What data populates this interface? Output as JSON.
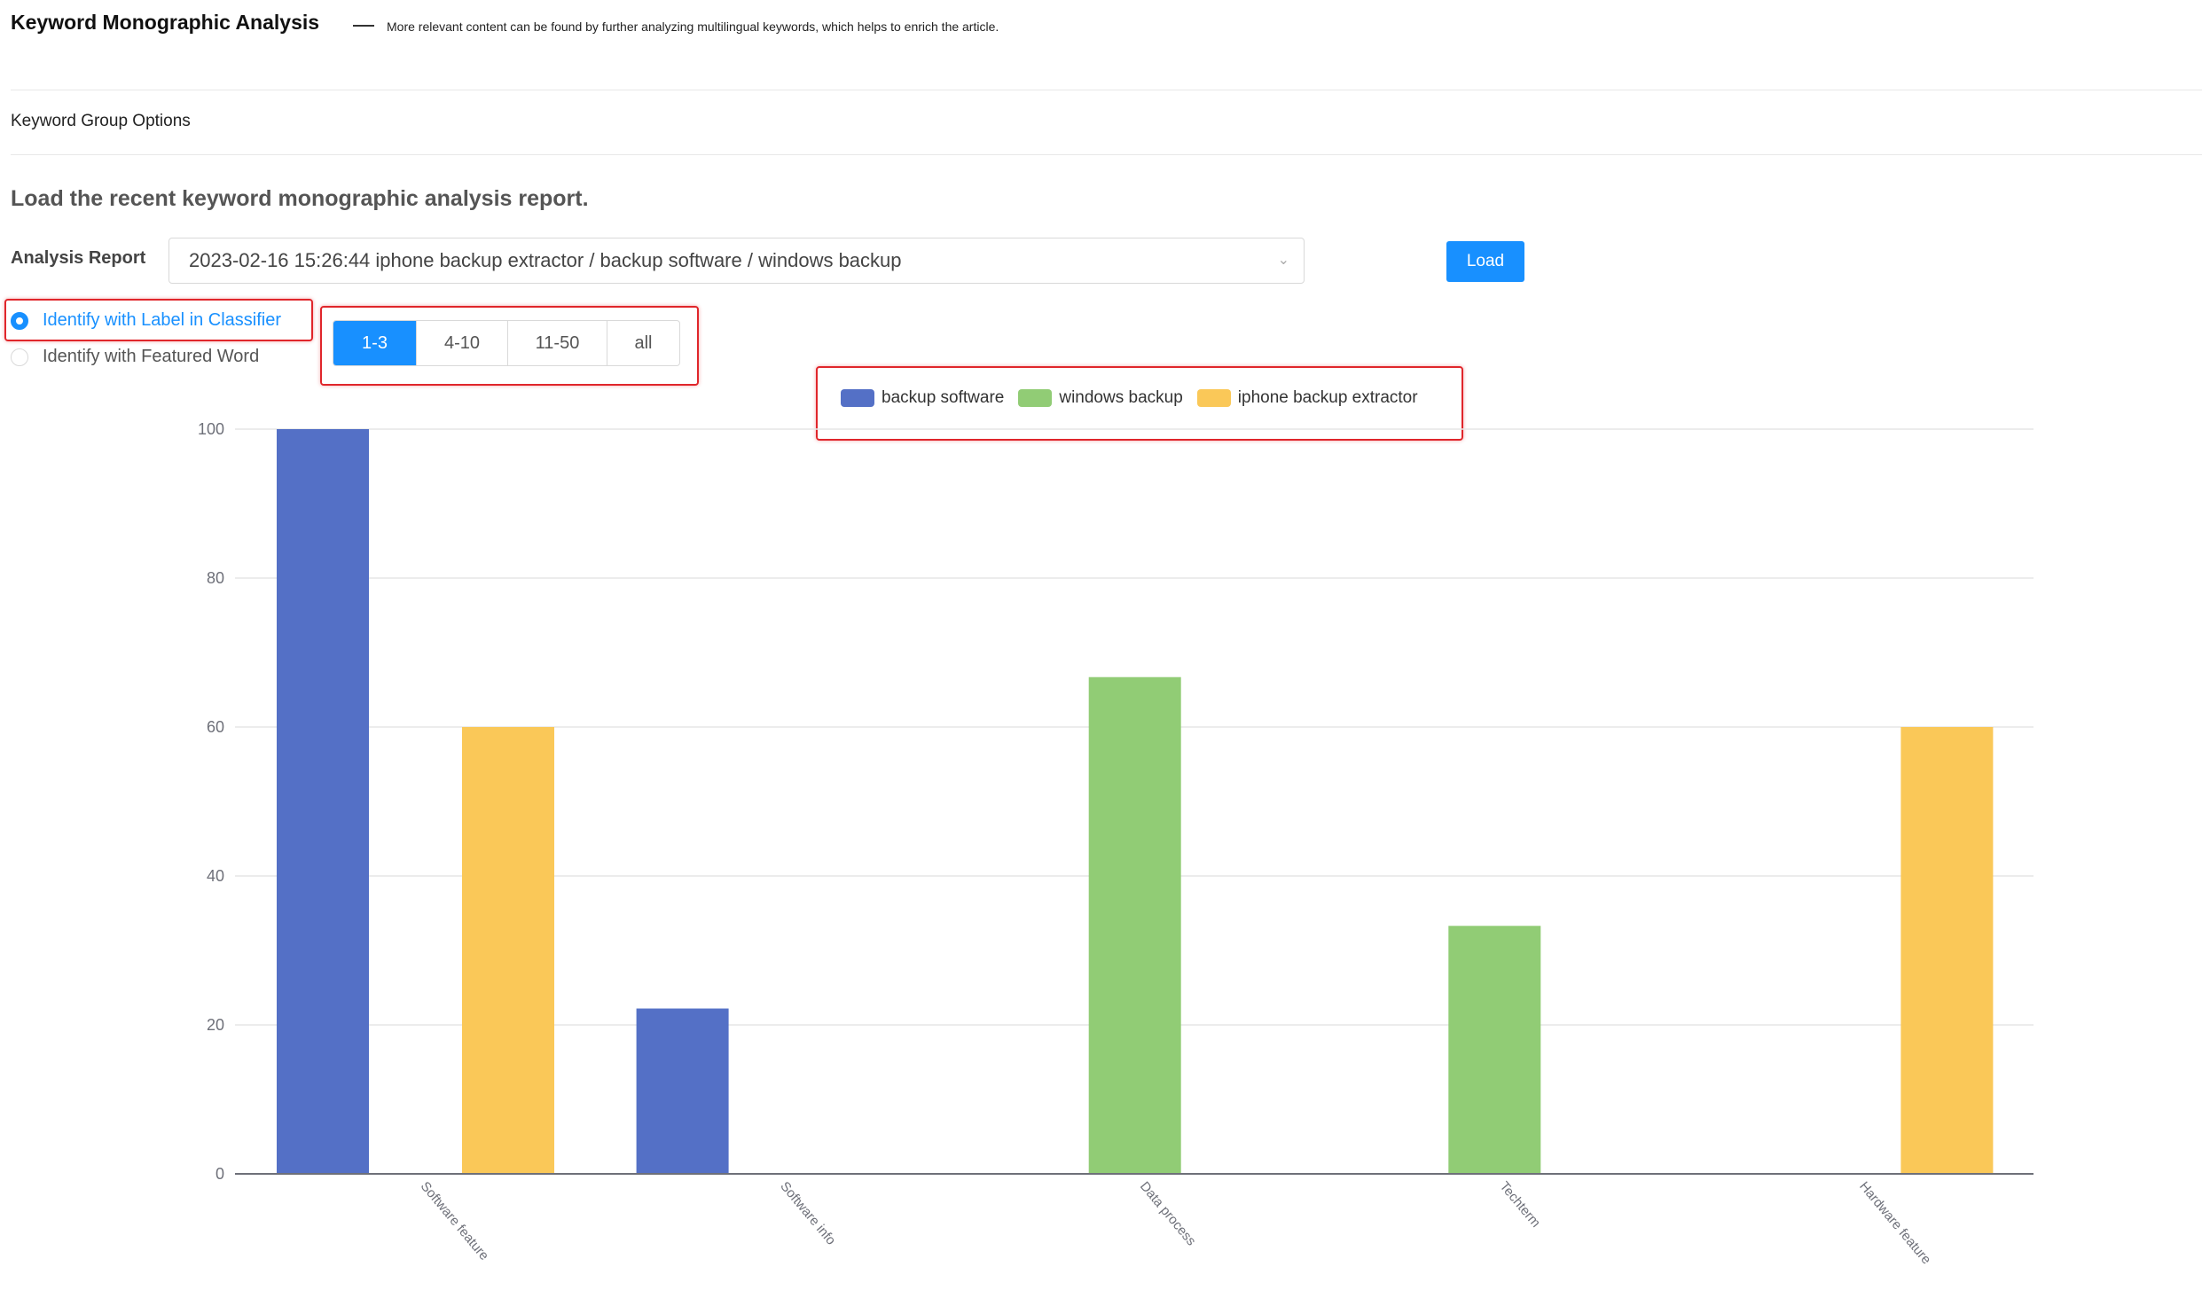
{
  "header": {
    "title": "Keyword Monographic Analysis",
    "subtitle": "More relevant content can be found by further analyzing multilingual keywords, which helps to enrich the article."
  },
  "section": {
    "label": "Keyword Group Options"
  },
  "load": {
    "heading": "Load the recent keyword monographic analysis report.",
    "report_label": "Analysis Report",
    "report_value": "2023-02-16 15:26:44 iphone backup extractor / backup software / windows backup",
    "button": "Load"
  },
  "radios": [
    {
      "label": "Identify with Label in Classifier",
      "checked": true
    },
    {
      "label": "Identify with Featured Word",
      "checked": false
    }
  ],
  "segments": [
    {
      "label": "1-3",
      "active": true
    },
    {
      "label": "4-10",
      "active": false
    },
    {
      "label": "11-50",
      "active": false
    },
    {
      "label": "all",
      "active": false
    }
  ],
  "accent": "#1890ff",
  "chart_data": {
    "type": "bar",
    "categories": [
      "Software feature",
      "Software info",
      "Data process",
      "Techterm",
      "Hardware feature"
    ],
    "series": [
      {
        "name": "backup software",
        "color": "#5470c6",
        "values": [
          100,
          22.2,
          0,
          0,
          0
        ]
      },
      {
        "name": "windows backup",
        "color": "#91cc75",
        "values": [
          0,
          0,
          66.7,
          33.3,
          0
        ]
      },
      {
        "name": "iphone backup extractor",
        "color": "#fac858",
        "values": [
          60,
          0,
          0,
          0,
          60
        ]
      }
    ],
    "ylim": [
      0,
      100
    ],
    "yticks": [
      "0",
      "20",
      "40",
      "60",
      "80",
      "100"
    ],
    "grid": true,
    "legend": "top-center"
  }
}
